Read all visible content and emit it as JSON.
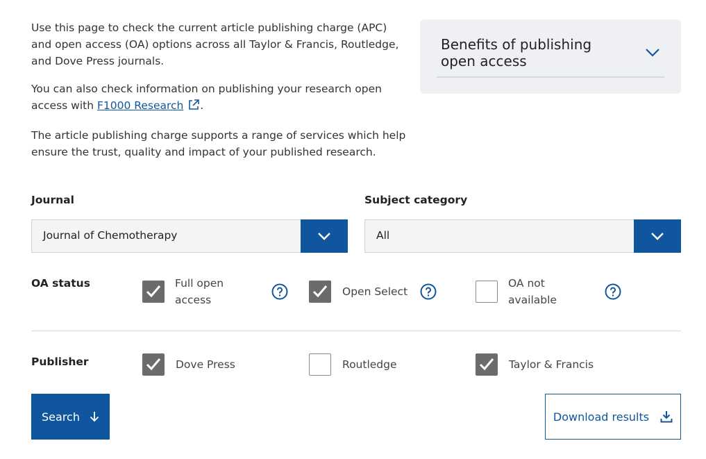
{
  "intro": {
    "para1": "Use this page to check the current article publishing charge (APC) and open access (OA) options across all Taylor & Francis, Routledge, and Dove Press journals.",
    "para2_before": "You can also check information on publishing your research open access with ",
    "para2_link": "F1000 Research",
    "para2_after": ".",
    "para3": "The article publishing charge supports a range of services which help ensure the trust, quality and impact of your published research."
  },
  "benefits": {
    "title": "Benefits of publishing open access"
  },
  "journal": {
    "label": "Journal",
    "value": "Journal of Chemotherapy"
  },
  "subject": {
    "label": "Subject category",
    "value": "All"
  },
  "oa_status": {
    "label": "OA status",
    "options": [
      {
        "label_line1": "Full open",
        "label_line2": "access",
        "checked": true
      },
      {
        "label": "Open Select",
        "checked": true
      },
      {
        "label_line1": "OA not",
        "label_line2": "available",
        "checked": false
      }
    ]
  },
  "publisher": {
    "label": "Publisher",
    "options": [
      {
        "label": "Dove Press",
        "checked": true
      },
      {
        "label": "Routledge",
        "checked": false
      },
      {
        "label": "Taylor & Francis",
        "checked": true
      }
    ]
  },
  "buttons": {
    "search": "Search",
    "download": "Download results"
  },
  "colors": {
    "accent": "#10569f",
    "checkbox_checked": "#6b6b6b",
    "panel": "#eef0f4"
  }
}
